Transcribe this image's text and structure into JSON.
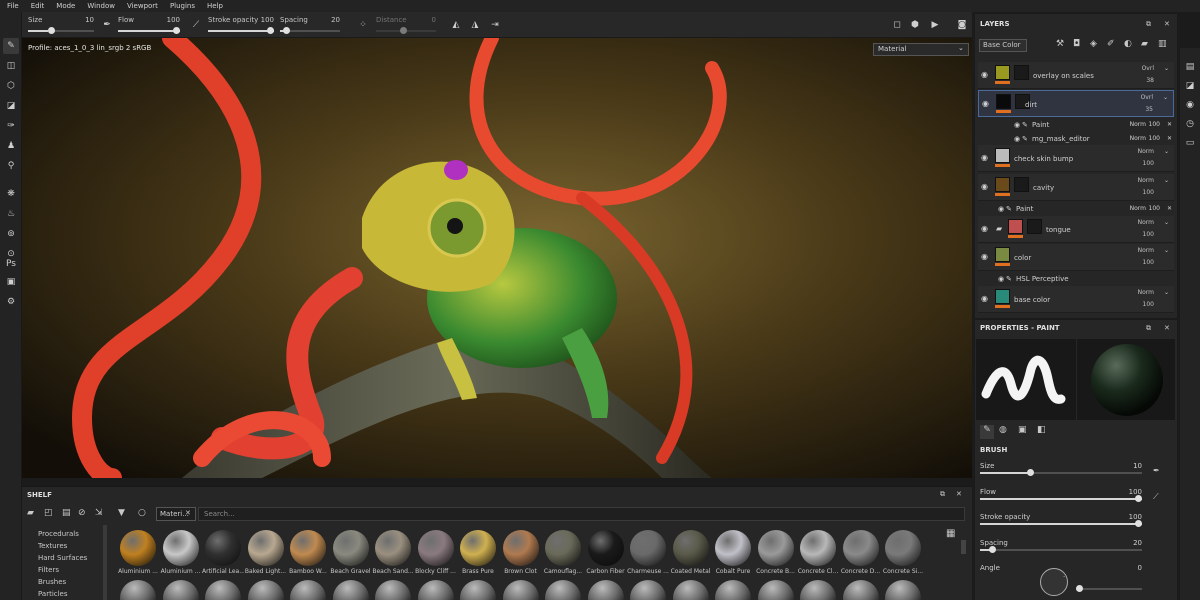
{
  "menu": [
    "File",
    "Edit",
    "Mode",
    "Window",
    "Viewport",
    "Plugins",
    "Help"
  ],
  "toolbar": {
    "size": {
      "label": "Size",
      "value": "10",
      "level": 0.3
    },
    "flow": {
      "label": "Flow",
      "value": "100",
      "level": 1.0
    },
    "stroke_opacity": {
      "label": "Stroke opacity",
      "value": "100",
      "level": 1.0
    },
    "spacing": {
      "label": "Spacing",
      "value": "20",
      "level": 0.06
    },
    "distance": {
      "label": "Distance",
      "value": "0"
    }
  },
  "viewport": {
    "profile": "Profile: aces_1_0_3 lin_srgb 2 sRGB",
    "mode_select": "Material"
  },
  "layers": {
    "title": "LAYERS",
    "channel": "Base Color",
    "rows": [
      {
        "name": "overlay on scales",
        "blend": "Ovrl",
        "opacity": "38",
        "thumb": "#9a9a20"
      },
      {
        "name": "dirt",
        "blend": "Ovrl",
        "opacity": "35",
        "thumb": "#0a0a0a"
      },
      {
        "name": "check skin bump",
        "blend": "Norm",
        "opacity": "100",
        "thumb": "#bbbbbb"
      },
      {
        "name": "cavity",
        "blend": "Norm",
        "opacity": "100",
        "thumb": "#6a4a1a"
      },
      {
        "name": "tongue",
        "blend": "Norm",
        "opacity": "100",
        "thumb": "#c05050"
      },
      {
        "name": "color",
        "blend": "Norm",
        "opacity": "100",
        "thumb": "#7a8a40"
      },
      {
        "name": "base color",
        "blend": "Norm",
        "opacity": "100",
        "thumb": "#2a8a7a"
      }
    ],
    "subs": [
      {
        "name": "Paint",
        "blend": "Norm",
        "opacity": "100"
      },
      {
        "name": "mg_mask_editor",
        "blend": "Norm",
        "opacity": "100"
      },
      {
        "name": "Paint",
        "blend": "Norm",
        "opacity": "100"
      },
      {
        "name": "HSL Perceptive",
        "blend": "",
        "opacity": ""
      }
    ]
  },
  "properties": {
    "title": "PROPERTIES - PAINT",
    "section": "BRUSH",
    "params": [
      {
        "label": "Size",
        "value": "10",
        "level": 0.3
      },
      {
        "label": "Flow",
        "value": "100",
        "level": 1.0
      },
      {
        "label": "Stroke opacity",
        "value": "100",
        "level": 1.0
      },
      {
        "label": "Spacing",
        "value": "20",
        "level": 0.06
      },
      {
        "label": "Angle",
        "value": "0",
        "level": 0.0
      }
    ]
  },
  "shelf": {
    "title": "SHELF",
    "categories": [
      "Procedurals",
      "Textures",
      "Hard Surfaces",
      "Filters",
      "Brushes",
      "Particles"
    ],
    "filter_tag": "Materi...",
    "search_placeholder": "Search...",
    "materials": [
      {
        "name": "Aluminium ...",
        "color": "#c08020"
      },
      {
        "name": "Aluminium ...",
        "color": "#c8c8c8"
      },
      {
        "name": "Artificial Lea...",
        "color": "#303030"
      },
      {
        "name": "Baked Light...",
        "color": "#b8a890"
      },
      {
        "name": "Bamboo W...",
        "color": "#c08a50"
      },
      {
        "name": "Beach Gravel",
        "color": "#8a8a80"
      },
      {
        "name": "Beach Sand...",
        "color": "#9a9080"
      },
      {
        "name": "Blocky Cliff ...",
        "color": "#8a7a80"
      },
      {
        "name": "Brass Pure",
        "color": "#d0b050"
      },
      {
        "name": "Brown Clot",
        "color": "#b07a50"
      },
      {
        "name": "Camouflag...",
        "color": "#6a6a5a"
      },
      {
        "name": "Carbon Fiber",
        "color": "#1a1a1a"
      },
      {
        "name": "Charmeuse ...",
        "color": "#6a6a6a"
      },
      {
        "name": "Coated Metal",
        "color": "#5a5a4a"
      },
      {
        "name": "Cobalt Pure",
        "color": "#c0c0c8"
      },
      {
        "name": "Concrete B...",
        "color": "#9a9a9a"
      },
      {
        "name": "Concrete Cl...",
        "color": "#b8b8b8"
      },
      {
        "name": "Concrete D...",
        "color": "#8a8a8a"
      },
      {
        "name": "Concrete Si...",
        "color": "#7a7a7a"
      }
    ]
  }
}
